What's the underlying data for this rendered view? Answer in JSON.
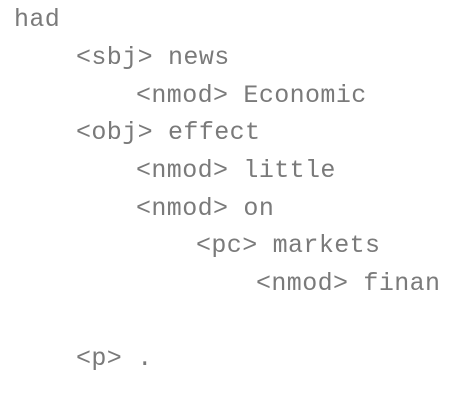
{
  "tree": {
    "root": "had",
    "nodes": [
      {
        "rel": "<sbj>",
        "word": "news"
      },
      {
        "rel": "<nmod>",
        "word": "Economic"
      },
      {
        "rel": "<obj>",
        "word": "effect"
      },
      {
        "rel": "<nmod>",
        "word": "little"
      },
      {
        "rel": "<nmod>",
        "word": "on"
      },
      {
        "rel": "<pc>",
        "word": "markets"
      },
      {
        "rel": "<nmod>",
        "word": "finan"
      },
      {
        "rel": "<p>",
        "word": "."
      }
    ]
  }
}
